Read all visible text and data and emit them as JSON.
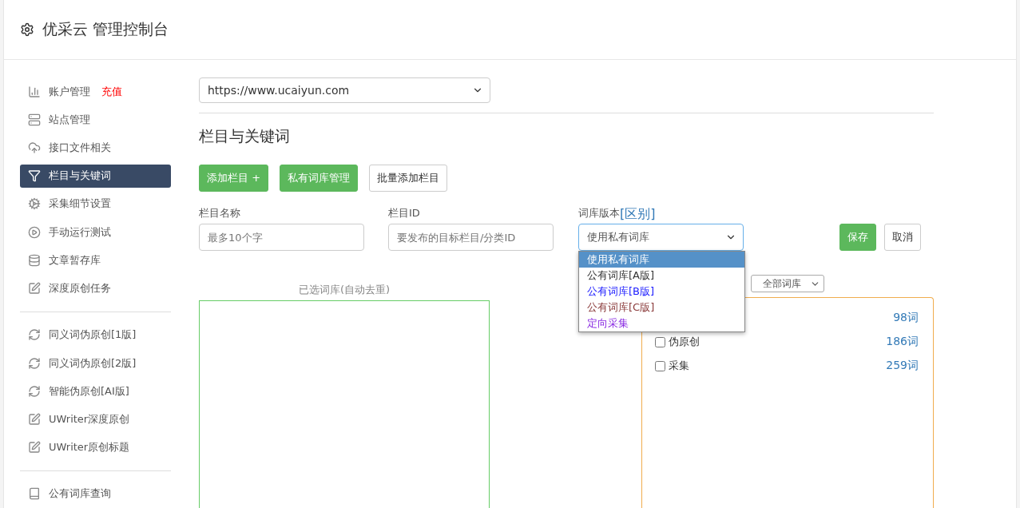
{
  "header": {
    "title": "优采云 管理控制台"
  },
  "sidebar": {
    "groups": [
      [
        {
          "label": "账户管理",
          "badge": "充值",
          "selected": false
        },
        {
          "label": "站点管理",
          "selected": false
        },
        {
          "label": "接口文件相关",
          "selected": false
        },
        {
          "label": "栏目与关键词",
          "selected": true
        },
        {
          "label": "采集细节设置",
          "selected": false
        },
        {
          "label": "手动运行测试",
          "selected": false
        },
        {
          "label": "文章暂存库",
          "selected": false
        },
        {
          "label": "深度原创任务",
          "selected": false
        }
      ],
      [
        {
          "label": "同义词伪原创[1版]",
          "selected": false
        },
        {
          "label": "同义词伪原创[2版]",
          "selected": false
        },
        {
          "label": "智能伪原创[AI版]",
          "selected": false
        },
        {
          "label": "UWriter深度原创",
          "selected": false
        },
        {
          "label": "UWriter原创标题",
          "selected": false
        }
      ],
      [
        {
          "label": "公有词库查询",
          "selected": false
        }
      ]
    ]
  },
  "site_select": {
    "value": "https://www.ucaiyun.com"
  },
  "section_title": "栏目与关键词",
  "buttons": [
    {
      "label": "添加栏目 +",
      "kind": "primary"
    },
    {
      "label": "私有词库管理",
      "kind": "primary"
    },
    {
      "label": "批量添加栏目",
      "kind": "default"
    }
  ],
  "form": {
    "name_label": "栏目名称",
    "name_placeholder": "最多10个字",
    "id_label": "栏目ID",
    "id_placeholder": "要发布的目标栏目/分类ID",
    "version_label": "词库版本",
    "version_link": "[区别]",
    "version_value": "使用私有词库",
    "save": "保存",
    "cancel": "取消",
    "options": [
      {
        "label": "使用私有词库",
        "selected": true
      },
      {
        "label": "公有词库[A版]",
        "selected": false,
        "color": "#333333"
      },
      {
        "label": "公有词库[B版]",
        "selected": false,
        "color": "#1a1aff"
      },
      {
        "label": "公有词库[C版]",
        "selected": false,
        "color": "#8a3a3a"
      },
      {
        "label": "定向采集",
        "selected": false,
        "color": "#8a2be2"
      }
    ]
  },
  "selected_panel": {
    "title": "已选词库(自动去重)"
  },
  "library_panel": {
    "filter": "全部词库",
    "rows": [
      {
        "count": "98词"
      },
      {
        "label": "伪原创",
        "count": "186词",
        "checked": false
      },
      {
        "label": "采集",
        "count": "259词",
        "checked": false
      }
    ]
  }
}
